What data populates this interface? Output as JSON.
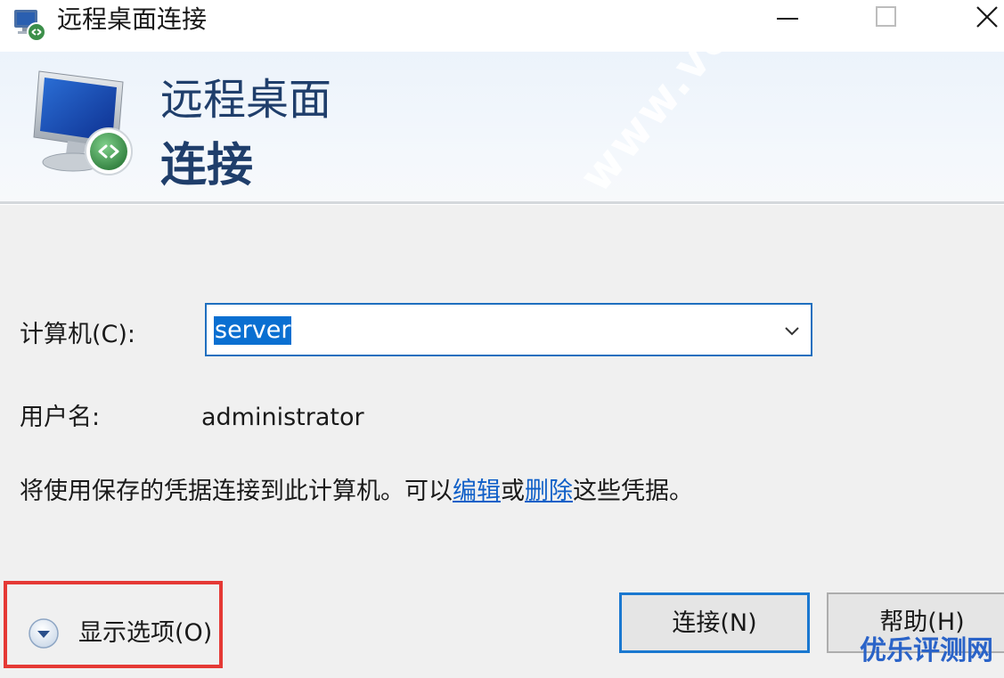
{
  "window": {
    "title": "远程桌面连接"
  },
  "header": {
    "line1": "远程桌面",
    "line2": "连接"
  },
  "form": {
    "computer_label": "计算机(C):",
    "computer_value": "server",
    "username_label": "用户名:",
    "username_value": "administrator",
    "info_before": "将使用保存的凭据连接到此计算机。可以",
    "info_edit_link": "编辑",
    "info_or": "或",
    "info_delete_link": "删除",
    "info_after": "这些凭据。"
  },
  "footer": {
    "show_options_label": "显示选项(O)",
    "connect_button": "连接(N)",
    "help_button": "帮助(H)"
  },
  "watermarks": {
    "diagonal": "www.veidc.com",
    "corner": "优乐评测网"
  },
  "colors": {
    "accent": "#1a78d0",
    "link": "#1060c8",
    "header_text": "#1f3e6b",
    "highlight_border": "#e53935",
    "selection": "#0a6fd1"
  },
  "icons": {
    "app": "remote-desktop-icon",
    "header": "remote-desktop-monitor-icon",
    "dropdown": "chevron-down-icon",
    "show_options": "expand-circle-icon"
  }
}
